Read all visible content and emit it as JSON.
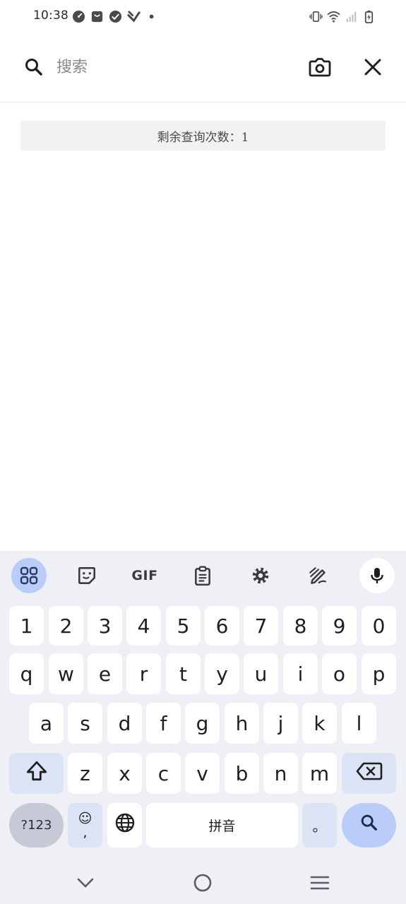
{
  "status_bar": {
    "time": "10:38",
    "left_icons": [
      "speedometer-icon",
      "shopping-bag-icon",
      "check-circle-icon",
      "cast-icon",
      "dot-icon"
    ],
    "right_icons": [
      "vibrate-icon",
      "wifi-icon",
      "signal-icon",
      "battery-charging-icon"
    ]
  },
  "search": {
    "placeholder": "搜索",
    "value": "",
    "search_icon": "search-icon",
    "camera_icon": "camera-icon",
    "close_icon": "close-icon"
  },
  "quota": {
    "text": "剩余查询次数：1"
  },
  "keyboard": {
    "toolbar": [
      "apps-grid-icon",
      "sticker-icon",
      "GIF",
      "clipboard-icon",
      "settings-gear-icon",
      "handwriting-icon",
      "microphone-icon"
    ],
    "number_row": [
      "1",
      "2",
      "3",
      "4",
      "5",
      "6",
      "7",
      "8",
      "9",
      "0"
    ],
    "row1": [
      "q",
      "w",
      "e",
      "r",
      "t",
      "y",
      "u",
      "i",
      "o",
      "p"
    ],
    "row2": [
      "a",
      "s",
      "d",
      "f",
      "g",
      "h",
      "j",
      "k",
      "l"
    ],
    "row3": [
      "z",
      "x",
      "c",
      "v",
      "b",
      "n",
      "m"
    ],
    "symbols_label": "?123",
    "emoji_top": "☺",
    "emoji_bottom": ",",
    "space_label": "拼音",
    "period_label": "。",
    "colors": {
      "background": "#eff0f6",
      "accent": "#b9cdf8",
      "special_key": "#dce3f7"
    }
  },
  "nav_bar": {
    "icons": [
      "back-chevron-icon",
      "home-circle-icon",
      "recents-menu-icon"
    ]
  }
}
